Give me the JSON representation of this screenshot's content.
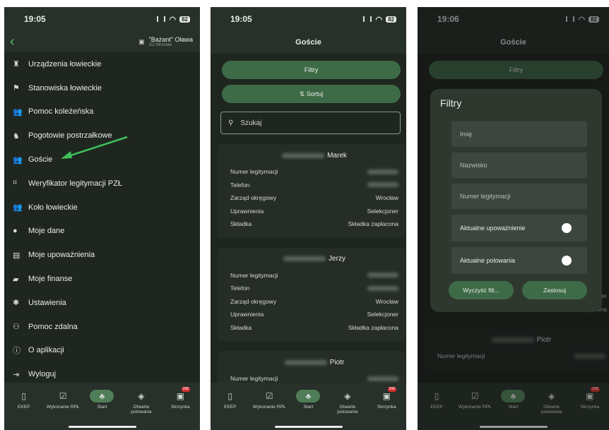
{
  "screens": [
    {
      "time": "19:05",
      "battery": "82"
    },
    {
      "time": "19:05",
      "battery": "82"
    },
    {
      "time": "19:06",
      "battery": "82"
    }
  ],
  "menu": {
    "club_name": "\"Bażant\" Oława",
    "club_sub": "ZO Wrocław",
    "items": [
      {
        "label": "Urządzenia łowieckie",
        "icon": "tower-icon"
      },
      {
        "label": "Stanowiska łowieckie",
        "icon": "flag-icon"
      },
      {
        "label": "Pomoc koleżeńska",
        "icon": "group-icon"
      },
      {
        "label": "Pogotowie postrzałkowe",
        "icon": "dog-icon"
      },
      {
        "label": "Goście",
        "icon": "group-icon"
      },
      {
        "label": "Weryfikator legitymacji PZŁ",
        "icon": "scan-icon"
      },
      {
        "label": "Koło łowieckie",
        "icon": "group-icon"
      },
      {
        "label": "Moje dane",
        "icon": "person-icon"
      },
      {
        "label": "Moje upoważnienia",
        "icon": "document-icon"
      },
      {
        "label": "Moje finanse",
        "icon": "wallet-icon"
      },
      {
        "label": "Ustawienia",
        "icon": "gear-icon"
      },
      {
        "label": "Pomoc zdalna",
        "icon": "support-icon"
      },
      {
        "label": "O aplikacji",
        "icon": "info-icon"
      },
      {
        "label": "Wyloguj",
        "icon": "logout-icon"
      }
    ]
  },
  "guests": {
    "title": "Goście",
    "filter_label": "Filtry",
    "sort_label": "Sortuj",
    "search_placeholder": "Szukaj",
    "field_labels": {
      "number": "Numer legitymacji",
      "phone": "Telefon",
      "board": "Zarząd okręgowy",
      "rights": "Uprawnienia",
      "fee": "Składka"
    },
    "cards": [
      {
        "name": "Marek",
        "board": "Wrocław",
        "rights": "Selekcjoner",
        "fee": "Składka zapłacona"
      },
      {
        "name": "Jerzy",
        "board": "Wrocław",
        "rights": "Selekcjoner",
        "fee": "Składka zapłacona"
      },
      {
        "name": "Piotr"
      }
    ]
  },
  "filters_modal": {
    "title": "Filtry",
    "first_name": "Imię",
    "last_name": "Nazwisko",
    "number": "Numer legitymacji",
    "toggle_authorization": "Aktualne upoważnienie",
    "toggle_hunts": "Aktualne polowania",
    "clear_label": "Wyczyść filt...",
    "apply_label": "Zastosuj"
  },
  "bottom_nav": [
    {
      "label": "EKEP",
      "icon": "book-icon"
    },
    {
      "label": "Wykonanie RPŁ",
      "icon": "calendar-check-icon"
    },
    {
      "label": "Start",
      "icon": "tree-icon",
      "active": true
    },
    {
      "label": "Otwarte polowania",
      "icon": "target-icon"
    },
    {
      "label": "Skrzynka",
      "icon": "inbox-icon",
      "badge": "299"
    }
  ]
}
